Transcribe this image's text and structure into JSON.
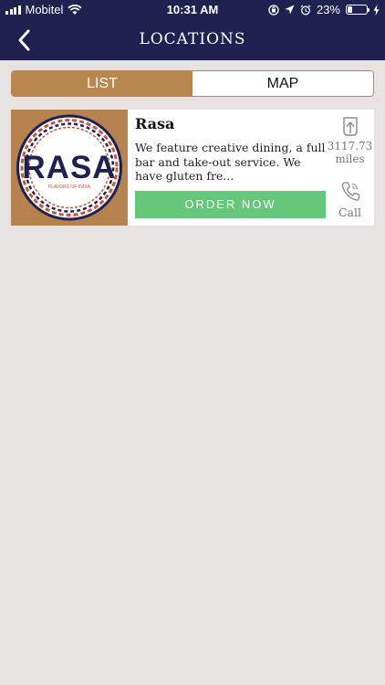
{
  "status_bar": {
    "carrier": "Mobitel",
    "time": "10:31 AM",
    "battery_percent": "23%",
    "battery_level": 0.23,
    "icons": [
      "signal-icon",
      "wifi-icon",
      "screen-lock-icon",
      "location-arrow-icon",
      "alarm-icon",
      "battery-icon",
      "charging-icon"
    ]
  },
  "nav": {
    "title": "LOCATIONS",
    "back_icon": "chevron-left-icon"
  },
  "tabs": [
    {
      "label": "LIST",
      "active": true
    },
    {
      "label": "MAP",
      "active": false
    }
  ],
  "locations": [
    {
      "name": "Rasa",
      "description": "We feature creative dining, a full bar and take-out service. We have gluten fre...",
      "order_label": "ORDER NOW",
      "distance_value": "3117.73",
      "distance_unit": "miles",
      "call_label": "Call",
      "logo": {
        "text": "RASA",
        "tagline": "FLAVORS OF INDIA"
      }
    }
  ],
  "colors": {
    "header": "#1f2150",
    "accent": "#b98650",
    "order_button": "#66c77a",
    "background": "#e7e3e2"
  }
}
